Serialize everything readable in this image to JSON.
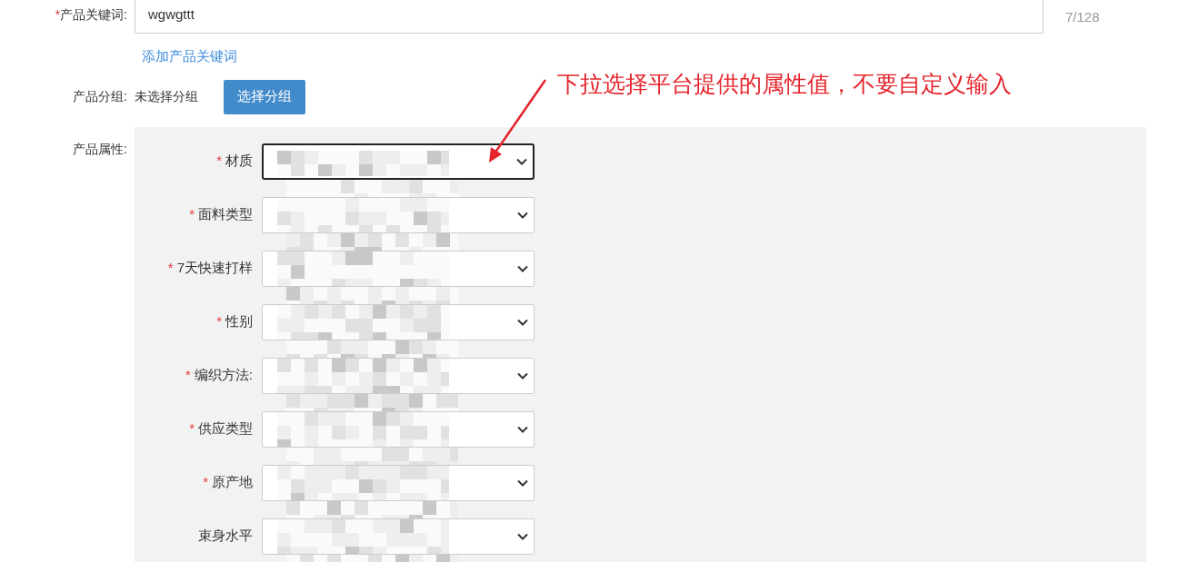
{
  "keyword": {
    "required_mark": "*",
    "label": "产品关键词:",
    "value": "wgwgttt",
    "counter": "7/128",
    "add_link": "添加产品关键词"
  },
  "group": {
    "label": "产品分组:",
    "status": "未选择分组",
    "button": "选择分组"
  },
  "attributes": {
    "label": "产品属性:",
    "fields": [
      {
        "required_mark": "*",
        "label": "材质",
        "focused": true
      },
      {
        "required_mark": "*",
        "label": "面料类型",
        "focused": false
      },
      {
        "required_mark": "*",
        "label": "7天快速打样",
        "focused": false
      },
      {
        "required_mark": "*",
        "label": "性别",
        "focused": false
      },
      {
        "required_mark": "*",
        "label": "编织方法:",
        "focused": false
      },
      {
        "required_mark": "*",
        "label": "供应类型",
        "focused": false
      },
      {
        "required_mark": "*",
        "label": "原产地",
        "focused": false
      },
      {
        "label": "束身水平",
        "focused": false
      }
    ]
  },
  "annotation": "下拉选择平台提供的属性值，不要自定义输入"
}
